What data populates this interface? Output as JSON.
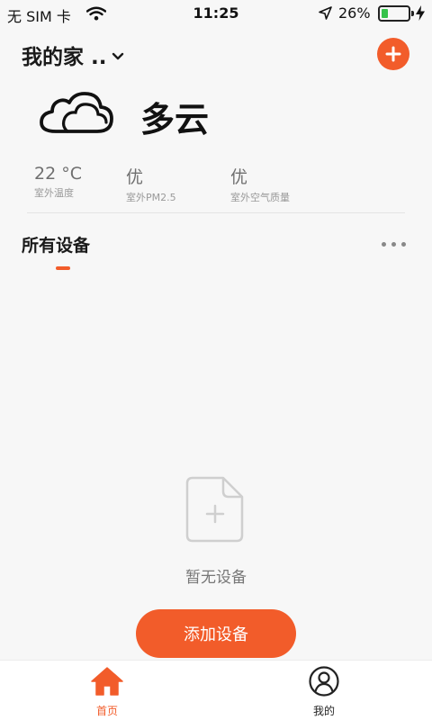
{
  "status_bar": {
    "carrier": "无 SIM 卡",
    "time": "11:25",
    "battery_percent": "26%",
    "battery_level": 0.26
  },
  "header": {
    "home_name": "我的家 ..",
    "add_icon": "plus-circle-icon"
  },
  "weather": {
    "condition": "多云",
    "icon": "cloudy-icon",
    "metrics": [
      {
        "value": "22 °C",
        "label": "室外温度"
      },
      {
        "value": "优",
        "label": "室外PM2.5"
      },
      {
        "value": "优",
        "label": "室外空气质量"
      }
    ]
  },
  "devices": {
    "section_title": "所有设备",
    "more_icon": "more-dots-icon",
    "empty_text": "暂无设备",
    "add_button_label": "添加设备"
  },
  "tab_bar": {
    "tabs": [
      {
        "label": "首页",
        "icon": "home-icon",
        "active": true
      },
      {
        "label": "我的",
        "icon": "profile-icon",
        "active": false
      }
    ]
  },
  "colors": {
    "accent": "#f25c2a",
    "background": "#f7f7f7",
    "battery_green": "#35c24a"
  }
}
